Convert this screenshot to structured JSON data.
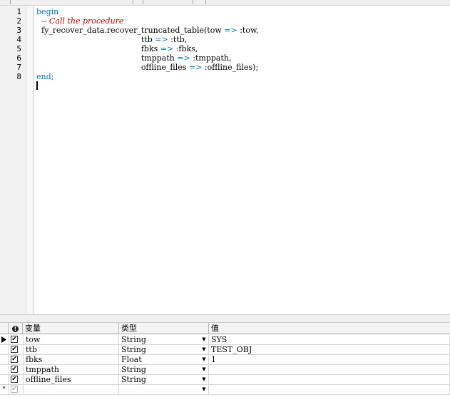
{
  "editor": {
    "line_numbers": [
      "1",
      "2",
      "3",
      "4",
      "5",
      "6",
      "7",
      "8"
    ],
    "lines": [
      {
        "parts": [
          {
            "t": "begin",
            "c": "kw"
          }
        ]
      },
      {
        "parts": [
          {
            "t": "  ",
            "c": ""
          },
          {
            "t": "-- Call the procedure",
            "c": "cmt"
          }
        ]
      },
      {
        "parts": [
          {
            "t": "  fy_recover_data.recover_truncated_table(tow ",
            "c": ""
          },
          {
            "t": "=>",
            "c": "kw"
          },
          {
            "t": " :tow,",
            "c": ""
          }
        ]
      },
      {
        "parts": [
          {
            "t": "                                          ttb ",
            "c": ""
          },
          {
            "t": "=>",
            "c": "kw"
          },
          {
            "t": " :ttb,",
            "c": ""
          }
        ]
      },
      {
        "parts": [
          {
            "t": "                                          fbks ",
            "c": ""
          },
          {
            "t": "=>",
            "c": "kw"
          },
          {
            "t": " :fbks,",
            "c": ""
          }
        ]
      },
      {
        "parts": [
          {
            "t": "                                          tmppath ",
            "c": ""
          },
          {
            "t": "=>",
            "c": "kw"
          },
          {
            "t": " :tmppath,",
            "c": ""
          }
        ]
      },
      {
        "parts": [
          {
            "t": "                                          offline_files ",
            "c": ""
          },
          {
            "t": "=>",
            "c": "kw"
          },
          {
            "t": " :offline_files);",
            "c": ""
          }
        ]
      },
      {
        "parts": [
          {
            "t": "end;",
            "c": "kw"
          }
        ]
      }
    ]
  },
  "grid": {
    "headers": {
      "enabled_icon": "!",
      "variable": "变量",
      "type": "类型",
      "value": "值"
    },
    "rows": [
      {
        "name": "tow",
        "type": "String",
        "value": "SYS",
        "checked": true,
        "current": true
      },
      {
        "name": "ttb",
        "type": "String",
        "value": "TEST_OBJ",
        "checked": true,
        "current": false
      },
      {
        "name": "fbks",
        "type": "Float",
        "value": "1",
        "checked": true,
        "current": false
      },
      {
        "name": "tmppath",
        "type": "String",
        "value": "",
        "checked": true,
        "current": false
      },
      {
        "name": "offline_files",
        "type": "String",
        "value": "",
        "checked": true,
        "current": false
      }
    ],
    "new_row": {
      "marker": "*",
      "checked": true
    }
  },
  "icons": {
    "current_row": "current-row-arrow-icon",
    "new_row": "new-row-asterisk-icon",
    "dropdown": "dropdown-arrow-icon"
  }
}
